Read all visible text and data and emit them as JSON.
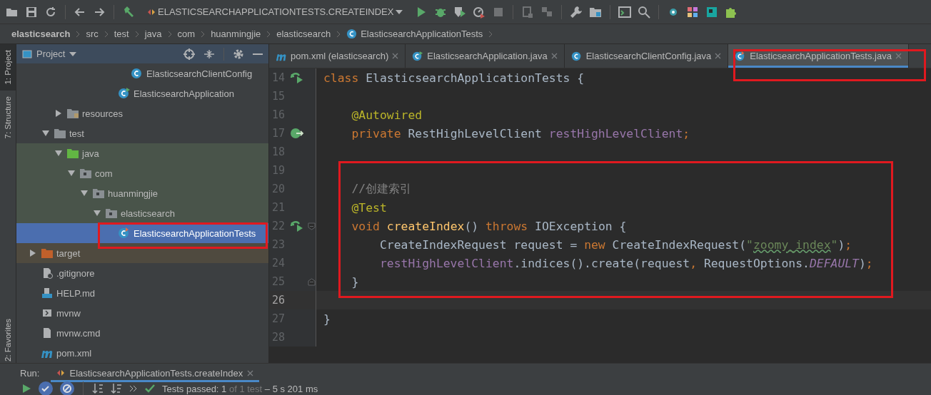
{
  "toolbar": {
    "items": [
      {
        "kind": "open",
        "disabled": false
      },
      {
        "kind": "save",
        "disabled": false
      },
      {
        "kind": "sync",
        "disabled": false
      },
      {
        "kind": "separator"
      },
      {
        "kind": "back",
        "disabled": false
      },
      {
        "kind": "forward",
        "disabled": false
      },
      {
        "kind": "separator"
      },
      {
        "kind": "build",
        "disabled": false
      },
      {
        "kind": "run_config",
        "label": "ELASTICSEARCHAPPLICATIONTESTS.CREATEINDEX"
      },
      {
        "kind": "run",
        "disabled": false
      },
      {
        "kind": "debug",
        "disabled": false
      },
      {
        "kind": "coverage",
        "disabled": false
      },
      {
        "kind": "profile",
        "disabled": false
      },
      {
        "kind": "stop",
        "disabled": true
      },
      {
        "kind": "separator"
      },
      {
        "kind": "device",
        "disabled": true
      },
      {
        "kind": "package",
        "disabled": true
      },
      {
        "kind": "separator"
      },
      {
        "kind": "wrench",
        "disabled": false
      },
      {
        "kind": "folder",
        "disabled": false
      },
      {
        "kind": "separator"
      },
      {
        "kind": "terminal",
        "disabled": false
      },
      {
        "kind": "search",
        "disabled": false
      },
      {
        "kind": "separator"
      },
      {
        "kind": "plugin_dot",
        "disabled": false
      },
      {
        "kind": "plugin_grid",
        "disabled": false
      },
      {
        "kind": "plugin_box",
        "disabled": false
      },
      {
        "kind": "puzzle",
        "disabled": false
      }
    ]
  },
  "breadcrumb": [
    {
      "label": "elasticsearch",
      "kind": "project"
    },
    {
      "label": "src",
      "kind": "dir"
    },
    {
      "label": "test",
      "kind": "dir"
    },
    {
      "label": "java",
      "kind": "dir"
    },
    {
      "label": "com",
      "kind": "dir"
    },
    {
      "label": "huanmingjie",
      "kind": "dir"
    },
    {
      "label": "elasticsearch",
      "kind": "dir"
    },
    {
      "label": "ElasticsearchApplicationTests",
      "kind": "test_class"
    }
  ],
  "side_stripe": [
    {
      "label": "1: Project",
      "kind": "project",
      "selected": true
    },
    {
      "label": "7: Structure",
      "kind": "structure",
      "selected": false
    },
    {
      "label": "2: Favorites",
      "kind": "favorites",
      "selected": false
    }
  ],
  "project_panel": {
    "title": "Project",
    "tree": [
      {
        "children": [
          {
            "children": [
              {
                "children": [
                  {
                    "children": [
                      {
                        "children": [
                          {
                            "children": [
                              {
                                "children": [
                                  {
                                    "label": "ElasticsearchClientConfig",
                                    "kind": "class",
                                    "selected": false
                                  }
                                ]
                              },
                              {
                                "label": "ElasticsearchApplication",
                                "kind": "app_class",
                                "selected": false
                              }
                            ]
                          }
                        ]
                      }
                    ]
                  }
                ]
              },
              {
                "label": "resources",
                "kind": "resources_folder",
                "expanded": false,
                "selected": false
              }
            ]
          },
          {
            "label": "test",
            "kind": "folder",
            "expanded": true,
            "selected": false,
            "children": [
              {
                "label": "java",
                "kind": "test_root",
                "expanded": true,
                "selected": false,
                "children": [
                  {
                    "label": "com",
                    "kind": "package",
                    "expanded": true,
                    "selected": false,
                    "children": [
                      {
                        "label": "huanmingjie",
                        "kind": "package",
                        "expanded": true,
                        "selected": false,
                        "children": [
                          {
                            "label": "elasticsearch",
                            "kind": "package",
                            "expanded": true,
                            "selected": false,
                            "children": [
                              {
                                "label": "ElasticsearchApplicationTests",
                                "kind": "test_class",
                                "selected": true,
                                "annotated": true
                              }
                            ]
                          }
                        ]
                      }
                    ]
                  }
                ]
              }
            ]
          }
        ]
      },
      {
        "label": "target",
        "kind": "excluded_folder",
        "expanded": false,
        "selected": false
      },
      {
        "label": ".gitignore",
        "kind": "ignore_file",
        "selected": false
      },
      {
        "label": "HELP.md",
        "kind": "md_file",
        "selected": false
      },
      {
        "label": "mvnw",
        "kind": "script_file",
        "selected": false
      },
      {
        "label": "mvnw.cmd",
        "kind": "text_file",
        "selected": false
      },
      {
        "label": "pom.xml",
        "kind": "maven_file",
        "selected": false
      }
    ]
  },
  "editor_tabs": [
    {
      "label": "pom.xml (elasticsearch)",
      "kind": "maven_file",
      "selected": false,
      "annotated": false
    },
    {
      "label": "ElasticsearchApplication.java",
      "kind": "app_class",
      "selected": false,
      "annotated": false
    },
    {
      "label": "ElasticsearchClientConfig.java",
      "kind": "class",
      "selected": false,
      "annotated": false
    },
    {
      "label": "ElasticsearchApplicationTests.java",
      "kind": "test_class",
      "selected": true,
      "annotated": true
    }
  ],
  "code": {
    "blocks": [
      {
        "annotated": false,
        "lines": [
          {
            "number": "14",
            "current": false,
            "run_marker": true,
            "tokens": [
              {
                "text": "class",
                "kind": "keyword"
              },
              {
                "text": " ElasticsearchApplicationTests {",
                "kind": "plain"
              }
            ]
          },
          {
            "number": "15",
            "current": false
          },
          {
            "number": "16",
            "current": false,
            "tokens": [
              {
                "text": "    @Autowired",
                "kind": "annotation"
              }
            ]
          },
          {
            "number": "17",
            "current": false,
            "bean_marker": true,
            "tokens": [
              {
                "text": "    private",
                "kind": "keyword"
              },
              {
                "text": " RestHighLevelClient ",
                "kind": "plain"
              },
              {
                "text": "restHighLevelClient",
                "kind": "field"
              },
              {
                "text": ";",
                "kind": "keyword"
              }
            ]
          },
          {
            "number": "18",
            "current": false
          }
        ]
      },
      {
        "annotated": true,
        "lines": [
          {
            "number": "19",
            "current": false
          },
          {
            "number": "20",
            "current": false,
            "tokens": [
              {
                "text": "    //创建索引",
                "kind": "comment"
              }
            ]
          },
          {
            "number": "21",
            "current": false,
            "tokens": [
              {
                "text": "    @Test",
                "kind": "annotation"
              }
            ]
          },
          {
            "number": "22",
            "current": false,
            "run_marker": true,
            "fold_start": true,
            "tokens": [
              {
                "text": "    void",
                "kind": "keyword"
              },
              {
                "text": " createIndex",
                "kind": "method"
              },
              {
                "text": "() ",
                "kind": "plain"
              },
              {
                "text": "throws",
                "kind": "keyword"
              },
              {
                "text": " IOException {",
                "kind": "plain"
              }
            ]
          },
          {
            "number": "23",
            "current": false,
            "tokens": [
              {
                "text": "        CreateIndexRequest request = ",
                "kind": "plain"
              },
              {
                "text": "new",
                "kind": "keyword"
              },
              {
                "text": " CreateIndexRequest(",
                "kind": "plain"
              },
              {
                "text": "\"",
                "kind": "string"
              },
              {
                "text": "zoomy_index",
                "kind": "string_typo"
              },
              {
                "text": "\"",
                "kind": "string"
              },
              {
                "text": ")",
                "kind": "plain"
              },
              {
                "text": ";",
                "kind": "keyword"
              }
            ]
          },
          {
            "number": "24",
            "current": false,
            "tokens": [
              {
                "text": "        restHighLevelClient",
                "kind": "field"
              },
              {
                "text": ".indices().create(request",
                "kind": "plain"
              },
              {
                "text": ",",
                "kind": "keyword"
              },
              {
                "text": " RequestOptions.",
                "kind": "plain"
              },
              {
                "text": "DEFAULT",
                "kind": "static_field"
              },
              {
                "text": ")",
                "kind": "plain"
              },
              {
                "text": ";",
                "kind": "keyword"
              }
            ]
          },
          {
            "number": "25",
            "current": false,
            "fold_end": true,
            "tokens": [
              {
                "text": "    }",
                "kind": "plain"
              }
            ]
          },
          {
            "number": "26",
            "current": true
          }
        ]
      },
      {
        "annotated": false,
        "lines": [
          {
            "number": "27",
            "current": false,
            "tokens": [
              {
                "text": "}",
                "kind": "plain"
              }
            ]
          },
          {
            "number": "28",
            "current": false
          }
        ]
      }
    ]
  },
  "run_panel": {
    "label": "Run:",
    "tab": {
      "label": "ElasticsearchApplicationTests.createIndex",
      "selected": true
    },
    "status": [
      {
        "text": "Tests passed: 1 ",
        "kind": "strong"
      },
      {
        "text": "of 1 test ",
        "kind": "muted"
      },
      {
        "text": "– 5 s 201 ms",
        "kind": "strong"
      }
    ]
  }
}
